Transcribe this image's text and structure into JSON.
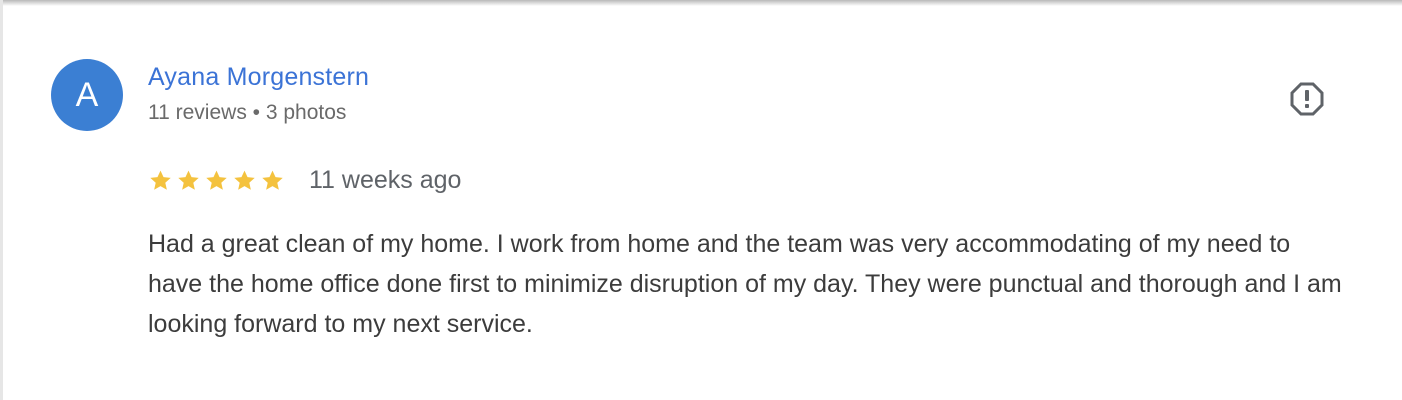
{
  "review": {
    "avatar_letter": "A",
    "reviewer_name": "Ayana Morgenstern",
    "reviewer_meta": "11 reviews • 3 photos",
    "rating": 5,
    "rating_max": 5,
    "date": "11 weeks ago",
    "text": "Had a great clean of my home. I work from home and the team was very accommodating of my need to have the home office done first to minimize disruption of my day. They were punctual and thorough and I am looking forward to my next service.",
    "flag_icon": "report-flag-icon"
  },
  "colors": {
    "avatar_bg": "#3b7fd3",
    "name": "#3b73d6",
    "star": "#f4c23e",
    "meta": "#6a6a6a",
    "text": "#3c3c3c"
  }
}
